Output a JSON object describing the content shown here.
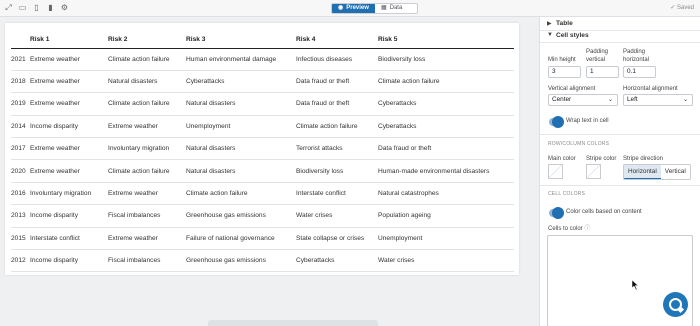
{
  "toolbar": {
    "preview_label": "Preview",
    "data_label": "Data",
    "saved_label": "Saved"
  },
  "table": {
    "headers": [
      "",
      "Risk 1",
      "Risk 2",
      "Risk 3",
      "Risk 4",
      "Risk 5"
    ],
    "rows": [
      [
        "2021",
        "Extreme weather",
        "Climate action failure",
        "Human environmental damage",
        "Infectious diseases",
        "Biodiversity loss"
      ],
      [
        "2018",
        "Extreme weather",
        "Natural disasters",
        "Cyberattacks",
        "Data fraud or theft",
        "Climate action failure"
      ],
      [
        "2019",
        "Extreme weather",
        "Climate action failure",
        "Natural disasters",
        "Data fraud or theft",
        "Cyberattacks"
      ],
      [
        "2014",
        "Income disparity",
        "Extreme weather",
        "Unemployment",
        "Climate action failure",
        "Cyberattacks"
      ],
      [
        "2017",
        "Extreme weather",
        "Involuntary migration",
        "Natural disasters",
        "Terrorist attacks",
        "Data fraud or theft"
      ],
      [
        "2020",
        "Extreme weather",
        "Climate action failure",
        "Natural disasters",
        "Biodiversity loss",
        "Human-made environmental disasters"
      ],
      [
        "2016",
        "Involuntary migration",
        "Extreme weather",
        "Climate action failure",
        "Interstate conflict",
        "Natural catastrophes"
      ],
      [
        "2013",
        "Income disparity",
        "Fiscal imbalances",
        "Greenhouse gas emissions",
        "Water crises",
        "Population ageing"
      ],
      [
        "2015",
        "Interstate conflict",
        "Extreme weather",
        "Failure of national governance",
        "State collapse or crises",
        "Unemployment"
      ],
      [
        "2012",
        "Income disparity",
        "Fiscal imbalances",
        "Greenhouse gas emissions",
        "Cyberattacks",
        "Water crises"
      ]
    ]
  },
  "sidebar": {
    "table_section": "Table",
    "cell_styles_section": "Cell styles",
    "min_height_label": "Min height",
    "min_height_value": "3",
    "padding_vertical_label_1": "Padding",
    "padding_vertical_label_2": "vertical",
    "padding_vertical_value": "1",
    "padding_horizontal_label_1": "Padding",
    "padding_horizontal_label_2": "horizontal",
    "padding_horizontal_value": "0.1",
    "vertical_alignment_label": "Vertical alignment",
    "vertical_alignment_value": "Center",
    "horizontal_alignment_label": "Horizontal alignment",
    "horizontal_alignment_value": "Left",
    "wrap_text_label": "Wrap text in cell",
    "row_column_colors_heading": "ROW/COLUMN COLORS",
    "main_color_label": "Main color",
    "stripe_color_label": "Stripe color",
    "stripe_direction_label": "Stripe direction",
    "stripe_horizontal": "Horizontal",
    "stripe_vertical": "Vertical",
    "cell_colors_heading": "CELL COLORS",
    "color_cells_label": "Color cells based on content",
    "cells_to_color_label": "Cells to color"
  },
  "colors": {
    "accent": "#1f6fb2"
  }
}
